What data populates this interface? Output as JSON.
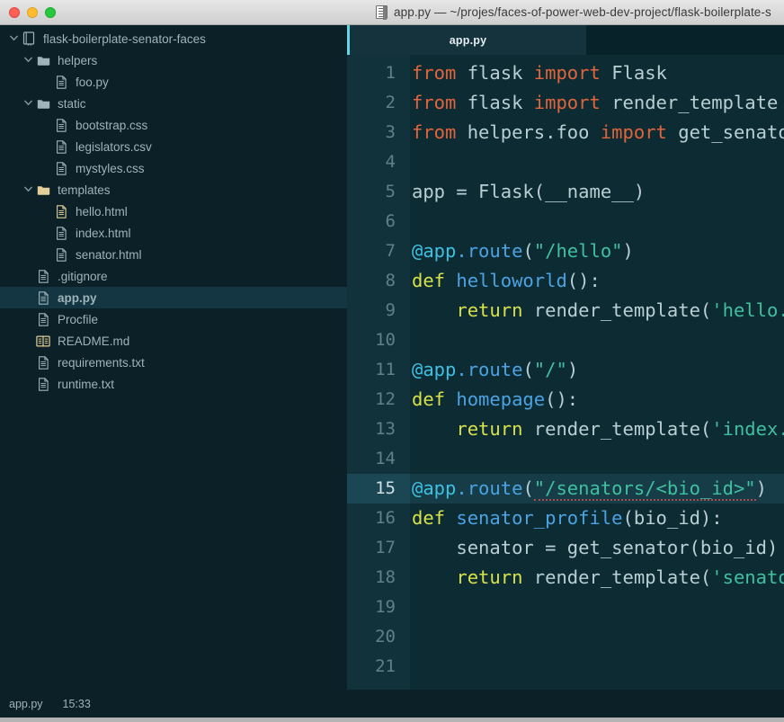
{
  "window": {
    "title": "app.py — ~/projes/faces-of-power-web-dev-project/flask-boilerplate-s",
    "title_icon": "document-icon",
    "traffic_lights": [
      "close",
      "minimize",
      "maximize"
    ],
    "colors": {
      "titlebar_bg": "#d9d9d9",
      "sidebar_bg": "#0b2027",
      "editor_bg": "#0d2b33",
      "gutter_bg": "#12323b",
      "tab_bg": "#14333d",
      "tab_accent": "#63d5e4",
      "selection_bg": "#133642",
      "active_line_bg": "#153c47"
    }
  },
  "sidebar": {
    "items": [
      {
        "label": "flask-boilerplate-senator-faces",
        "depth": 0,
        "icon": "repo-icon",
        "chevron": "down",
        "color": "default",
        "selected": false
      },
      {
        "label": "helpers",
        "depth": 1,
        "icon": "folder-icon",
        "chevron": "down",
        "color": "default",
        "selected": false
      },
      {
        "label": "foo.py",
        "depth": 2,
        "icon": "file-icon",
        "chevron": "",
        "color": "default",
        "selected": false
      },
      {
        "label": "static",
        "depth": 1,
        "icon": "folder-icon",
        "chevron": "down",
        "color": "default",
        "selected": false
      },
      {
        "label": "bootstrap.css",
        "depth": 2,
        "icon": "file-icon",
        "chevron": "",
        "color": "default",
        "selected": false
      },
      {
        "label": "legislators.csv",
        "depth": 2,
        "icon": "file-icon",
        "chevron": "",
        "color": "default",
        "selected": false
      },
      {
        "label": "mystyles.css",
        "depth": 2,
        "icon": "file-icon",
        "chevron": "",
        "color": "default",
        "selected": false
      },
      {
        "label": "templates",
        "depth": 1,
        "icon": "folder-gold-icon",
        "chevron": "down",
        "color": "gold",
        "selected": false
      },
      {
        "label": "hello.html",
        "depth": 2,
        "icon": "file-gold-icon",
        "chevron": "",
        "color": "gold",
        "selected": false
      },
      {
        "label": "index.html",
        "depth": 2,
        "icon": "file-icon",
        "chevron": "",
        "color": "default",
        "selected": false
      },
      {
        "label": "senator.html",
        "depth": 2,
        "icon": "file-icon",
        "chevron": "",
        "color": "default",
        "selected": false
      },
      {
        "label": ".gitignore",
        "depth": 1,
        "icon": "file-icon",
        "chevron": "",
        "color": "default",
        "selected": false
      },
      {
        "label": "app.py",
        "depth": 1,
        "icon": "file-icon",
        "chevron": "",
        "color": "white",
        "selected": true
      },
      {
        "label": "Procfile",
        "depth": 1,
        "icon": "file-icon",
        "chevron": "",
        "color": "default",
        "selected": false
      },
      {
        "label": "README.md",
        "depth": 1,
        "icon": "book-gold-icon",
        "chevron": "",
        "color": "gold",
        "selected": false
      },
      {
        "label": "requirements.txt",
        "depth": 1,
        "icon": "file-icon",
        "chevron": "",
        "color": "default",
        "selected": false
      },
      {
        "label": "runtime.txt",
        "depth": 1,
        "icon": "file-icon",
        "chevron": "",
        "color": "default",
        "selected": false
      }
    ]
  },
  "editor": {
    "tabs": [
      {
        "label": "app.py",
        "active": true
      }
    ],
    "active_line": 15,
    "line_numbers": [
      1,
      2,
      3,
      4,
      5,
      6,
      7,
      8,
      9,
      10,
      11,
      12,
      13,
      14,
      15,
      16,
      17,
      18,
      19,
      20,
      21
    ],
    "code_lines": [
      {
        "n": 1,
        "tokens": [
          {
            "t": "from ",
            "c": "kw"
          },
          {
            "t": "flask ",
            "c": "plain"
          },
          {
            "t": "import ",
            "c": "kw"
          },
          {
            "t": "Flask",
            "c": "plain"
          }
        ]
      },
      {
        "n": 2,
        "tokens": [
          {
            "t": "from ",
            "c": "kw"
          },
          {
            "t": "flask ",
            "c": "plain"
          },
          {
            "t": "import ",
            "c": "kw"
          },
          {
            "t": "render_template",
            "c": "plain"
          }
        ]
      },
      {
        "n": 3,
        "tokens": [
          {
            "t": "from ",
            "c": "kw"
          },
          {
            "t": "helpers.foo ",
            "c": "plain"
          },
          {
            "t": "import ",
            "c": "kw"
          },
          {
            "t": "get_senator",
            "c": "plain"
          }
        ]
      },
      {
        "n": 4,
        "tokens": []
      },
      {
        "n": 5,
        "tokens": [
          {
            "t": "app = Flask(__name__)",
            "c": "plain"
          }
        ]
      },
      {
        "n": 6,
        "tokens": []
      },
      {
        "n": 7,
        "tokens": [
          {
            "t": "@app",
            "c": "dec"
          },
          {
            "t": ".route",
            "c": "decat"
          },
          {
            "t": "(",
            "c": "plain"
          },
          {
            "t": "\"/hello\"",
            "c": "str"
          },
          {
            "t": ")",
            "c": "plain"
          }
        ]
      },
      {
        "n": 8,
        "tokens": [
          {
            "t": "def ",
            "c": "def"
          },
          {
            "t": "helloworld",
            "c": "fn"
          },
          {
            "t": "():",
            "c": "plain"
          }
        ]
      },
      {
        "n": 9,
        "tokens": [
          {
            "t": "    ",
            "c": "plain"
          },
          {
            "t": "return ",
            "c": "ret"
          },
          {
            "t": "render_template(",
            "c": "plain"
          },
          {
            "t": "'hello.html'",
            "c": "str"
          },
          {
            "t": ")",
            "c": "plain"
          }
        ]
      },
      {
        "n": 10,
        "tokens": []
      },
      {
        "n": 11,
        "tokens": [
          {
            "t": "@app",
            "c": "dec"
          },
          {
            "t": ".route",
            "c": "decat"
          },
          {
            "t": "(",
            "c": "plain"
          },
          {
            "t": "\"/\"",
            "c": "str"
          },
          {
            "t": ")",
            "c": "plain"
          }
        ]
      },
      {
        "n": 12,
        "tokens": [
          {
            "t": "def ",
            "c": "def"
          },
          {
            "t": "homepage",
            "c": "fn"
          },
          {
            "t": "():",
            "c": "plain"
          }
        ]
      },
      {
        "n": 13,
        "tokens": [
          {
            "t": "    ",
            "c": "plain"
          },
          {
            "t": "return ",
            "c": "ret"
          },
          {
            "t": "render_template(",
            "c": "plain"
          },
          {
            "t": "'index.html'",
            "c": "str"
          },
          {
            "t": ")",
            "c": "plain"
          }
        ]
      },
      {
        "n": 14,
        "tokens": []
      },
      {
        "n": 15,
        "tokens": [
          {
            "t": "@app",
            "c": "dec"
          },
          {
            "t": ".route",
            "c": "decat"
          },
          {
            "t": "(",
            "c": "plain"
          },
          {
            "t": "\"/senators/<bio_id>\"",
            "c": "str-spell"
          },
          {
            "t": ")",
            "c": "plain"
          }
        ]
      },
      {
        "n": 16,
        "tokens": [
          {
            "t": "def ",
            "c": "def"
          },
          {
            "t": "senator_profile",
            "c": "fn"
          },
          {
            "t": "(bio_id):",
            "c": "plain"
          }
        ]
      },
      {
        "n": 17,
        "tokens": [
          {
            "t": "    senator = get_senator(bio_id)",
            "c": "plain"
          }
        ]
      },
      {
        "n": 18,
        "tokens": [
          {
            "t": "    ",
            "c": "plain"
          },
          {
            "t": "return ",
            "c": "ret"
          },
          {
            "t": "render_template(",
            "c": "plain"
          },
          {
            "t": "'senator.html'",
            "c": "str"
          },
          {
            "t": ")",
            "c": "plain"
          }
        ]
      },
      {
        "n": 19,
        "tokens": []
      },
      {
        "n": 20,
        "tokens": []
      },
      {
        "n": 21,
        "tokens": []
      }
    ]
  },
  "statusbar": {
    "filename": "app.py",
    "time": "15:33"
  }
}
